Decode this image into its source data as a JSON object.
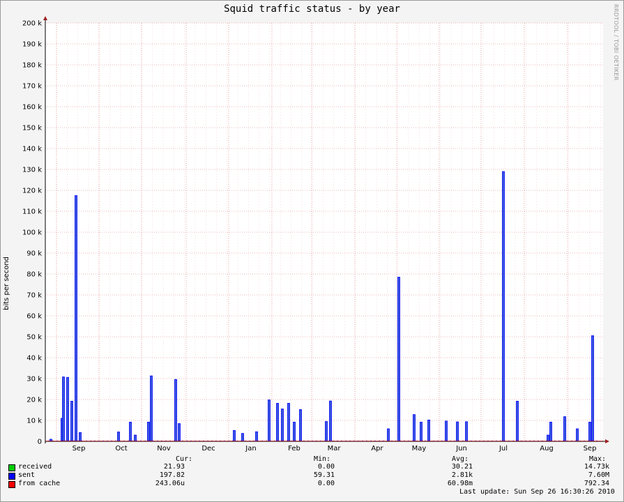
{
  "chart_data": {
    "type": "bar",
    "title": "Squid traffic status - by year",
    "ylabel": "bits per second",
    "watermark": "RRDTOOL / TOBI OETIKER",
    "ylim": [
      0,
      200000
    ],
    "yticks": [
      "0",
      "10 k",
      "20 k",
      "30 k",
      "40 k",
      "50 k",
      "60 k",
      "70 k",
      "80 k",
      "90 k",
      "100 k",
      "110 k",
      "120 k",
      "130 k",
      "140 k",
      "150 k",
      "160 k",
      "170 k",
      "180 k",
      "190 k",
      "200 k"
    ],
    "xticks": [
      "Sep",
      "Oct",
      "Nov",
      "Dec",
      "Jan",
      "Feb",
      "Mar",
      "Apr",
      "May",
      "Jun",
      "Jul",
      "Aug",
      "Sep"
    ],
    "colors": {
      "received": "#00cc00",
      "sent": "#0000ff",
      "from_cache": "#ff0000",
      "sent_fill": "#3b5bd9"
    },
    "series": [
      {
        "name": "sent",
        "values": [
          {
            "x": "Aug wk1",
            "y": 1000
          },
          {
            "x": "Aug wk3",
            "y": 11000
          },
          {
            "x": "Aug wk3b",
            "y": 30800
          },
          {
            "x": "Aug wk4",
            "y": 30600
          },
          {
            "x": "Aug wk4b",
            "y": 19200
          },
          {
            "x": "Aug wk5",
            "y": 117500
          },
          {
            "x": "Sep wk1",
            "y": 4200
          },
          {
            "x": "Oct wk1",
            "y": 4500
          },
          {
            "x": "Oct wk2",
            "y": 9200
          },
          {
            "x": "Oct wk3",
            "y": 3000
          },
          {
            "x": "Oct wk5",
            "y": 9200
          },
          {
            "x": "Nov wk1",
            "y": 31300
          },
          {
            "x": "Nov wk5",
            "y": 29600
          },
          {
            "x": "Dec wk1",
            "y": 8500
          },
          {
            "x": "Jan wk1",
            "y": 5200
          },
          {
            "x": "Jan wk3",
            "y": 3800
          },
          {
            "x": "Jan wk4",
            "y": 4600
          },
          {
            "x": "Jan wk5",
            "y": 19800
          },
          {
            "x": "Feb wk1",
            "y": 18200
          },
          {
            "x": "Feb wk2",
            "y": 15500
          },
          {
            "x": "Feb wk3",
            "y": 18200
          },
          {
            "x": "Feb wk4",
            "y": 9200
          },
          {
            "x": "Feb wk4b",
            "y": 15200
          },
          {
            "x": "Mar wk1",
            "y": 9500
          },
          {
            "x": "Mar wk2",
            "y": 19300
          },
          {
            "x": "Apr wk3",
            "y": 6000
          },
          {
            "x": "Apr wk4",
            "y": 78500
          },
          {
            "x": "May wk1",
            "y": 12800
          },
          {
            "x": "May wk2",
            "y": 9200
          },
          {
            "x": "May wk3",
            "y": 10200
          },
          {
            "x": "Jun wk1",
            "y": 9700
          },
          {
            "x": "Jun wk2",
            "y": 9300
          },
          {
            "x": "Jun wk3",
            "y": 9400
          },
          {
            "x": "Jul wk1",
            "y": 129000
          },
          {
            "x": "Jul wk3",
            "y": 19200
          },
          {
            "x": "Aug wk1",
            "y": 3000
          },
          {
            "x": "Aug wk2",
            "y": 9200
          },
          {
            "x": "Aug wk4",
            "y": 11800
          },
          {
            "x": "Aug wk5",
            "y": 6000
          },
          {
            "x": "Sep wk2",
            "y": 9200
          },
          {
            "x": "Sep wk3",
            "y": 50500
          }
        ]
      }
    ]
  },
  "legend": {
    "headers": {
      "cur": "Cur:",
      "min": "Min:",
      "avg": "Avg:",
      "max": "Max:"
    },
    "rows": [
      {
        "label": "received",
        "cur": "21.93",
        "min": "0.00",
        "avg": "30.21",
        "max": "14.73k"
      },
      {
        "label": "sent",
        "cur": "197.82",
        "min": "59.31",
        "avg": "2.81k",
        "max": "7.60M"
      },
      {
        "label": "from cache",
        "cur": "243.06u",
        "min": "0.00",
        "avg": "60.98m",
        "max": "792.34"
      }
    ],
    "last_update": "Last update: Sun Sep 26 16:30:26 2010"
  }
}
